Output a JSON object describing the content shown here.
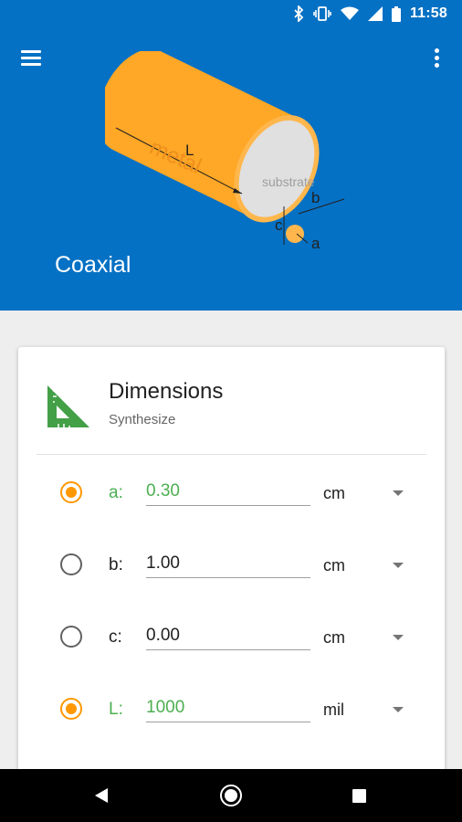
{
  "status_bar": {
    "time": "11:58",
    "icons": [
      "bluetooth-icon",
      "vibrate-icon",
      "wifi-icon",
      "signal-icon",
      "battery-icon"
    ]
  },
  "app_bar": {
    "menu_icon": "hamburger-menu-icon",
    "more_icon": "more-vert-icon",
    "title": "Coaxial",
    "background_color": "#0571c4"
  },
  "illustration": {
    "labels": {
      "length": "L",
      "material": "metal",
      "substrate": "substrate",
      "outer": "b",
      "offset": "c",
      "inner": "a"
    },
    "colors": {
      "metal": "#ffa726",
      "substrate": "#e0e0e0",
      "core": "#ffb74d"
    }
  },
  "card": {
    "title": "Dimensions",
    "subtitle": "Synthesize",
    "icon": "set-square-ruler-icon",
    "accent_active": "#4caf50",
    "radio_color": "#ff9800"
  },
  "dimensions": [
    {
      "label": "a:",
      "value": "0.30",
      "unit": "cm",
      "selected": true
    },
    {
      "label": "b:",
      "value": "1.00",
      "unit": "cm",
      "selected": false
    },
    {
      "label": "c:",
      "value": "0.00",
      "unit": "cm",
      "selected": false
    },
    {
      "label": "L:",
      "value": "1000",
      "unit": "mil",
      "selected": true
    }
  ],
  "nav_bar": {
    "back_icon": "back-triangle-icon",
    "home_icon": "home-circle-icon",
    "recents_icon": "recents-square-icon"
  }
}
